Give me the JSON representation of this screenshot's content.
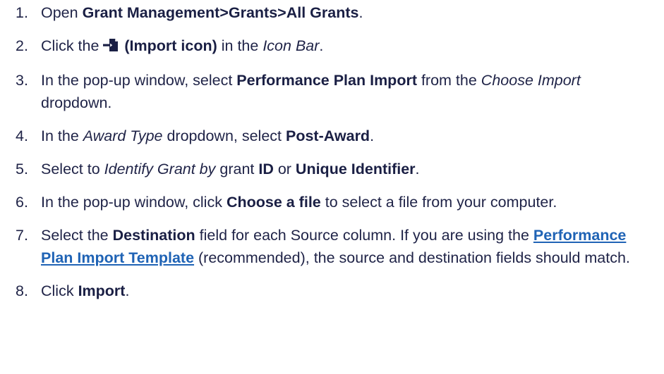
{
  "steps": [
    {
      "num": "1.",
      "t1": "Open ",
      "b1": "Grant Management>Grants>All Grants",
      "t2": "."
    },
    {
      "num": "2.",
      "t1": "Click the ",
      "icon": "import-icon",
      "b1": " (Import icon)",
      "t2": " in the ",
      "i1": "Icon Bar",
      "t3": "."
    },
    {
      "num": "3.",
      "t1": "In the pop-up window, select ",
      "b1": "Performance Plan Import",
      "t2": " from the ",
      "i1": "Choose Import",
      "t3": " dropdown."
    },
    {
      "num": "4.",
      "t1": "In the ",
      "i1": "Award Type",
      "t2": " dropdown, select ",
      "b1": "Post-Award",
      "t3": "."
    },
    {
      "num": "5.",
      "t1": "Select to ",
      "i1": "Identify Grant by",
      "t2": " grant ",
      "b1": "ID",
      "t3": " or ",
      "b2": "Unique Identifier",
      "t4": "."
    },
    {
      "num": "6.",
      "t1": "In the pop-up window, click ",
      "b1": "Choose a file",
      "t2": " to select a file from your computer."
    },
    {
      "num": "7.",
      "t1": "Select the ",
      "b1": "Destination",
      "t2": " field for each Source column. If you are using the ",
      "link": "Performance Plan Import Template",
      "t3": " (recommended), the source and destination fields should match."
    },
    {
      "num": "8.",
      "t1": "Click ",
      "b1": "Import",
      "t2": "."
    }
  ],
  "colors": {
    "text": "#1f2347",
    "link": "#1f63b5"
  }
}
